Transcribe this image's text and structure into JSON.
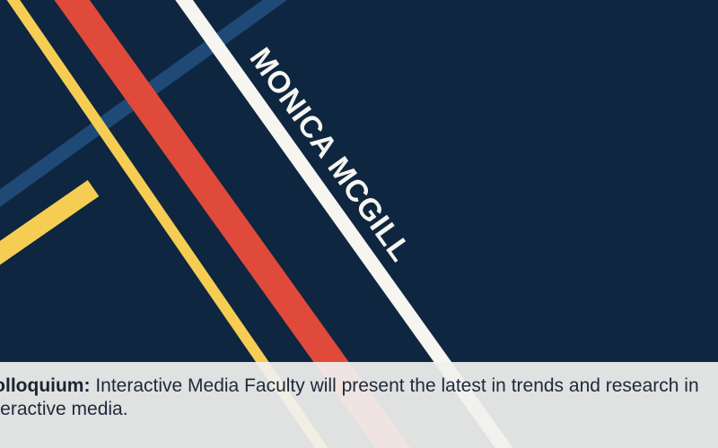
{
  "speaker": {
    "name": "MONICA MCGILL"
  },
  "caption": {
    "lead": "Colloquium:",
    "body": " Interactive Media Faculty will present the latest in trends and research in interactive media."
  },
  "colors": {
    "background": "#0e2640",
    "navy_stripe": "#1f4a78",
    "yellow": "#f6cd53",
    "red": "#e04a3a",
    "white": "#f7f5ef",
    "caption_bg": "#f0f0ee",
    "caption_text": "#1c2a3a"
  }
}
